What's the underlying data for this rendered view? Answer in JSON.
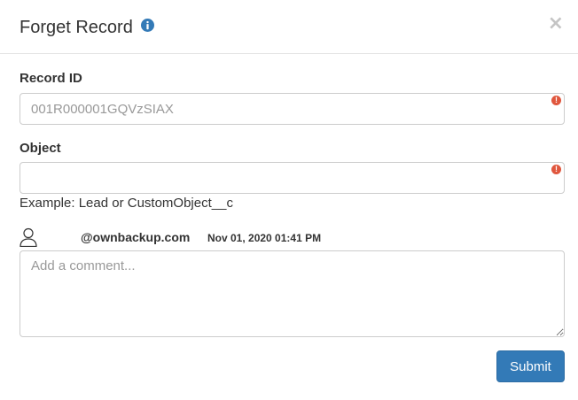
{
  "modal": {
    "title": "Forget Record",
    "close_glyph": "×"
  },
  "record_id": {
    "label": "Record ID",
    "value": "",
    "placeholder": "001R000001GQVzSIAX"
  },
  "object": {
    "label": "Object",
    "value": "",
    "placeholder": "",
    "help_text": "Example: Lead or CustomObject__c"
  },
  "comment": {
    "author_email": "@ownbackup.com",
    "timestamp": "Nov 01, 2020 01:41 PM",
    "placeholder": "Add a comment..."
  },
  "actions": {
    "submit_label": "Submit"
  },
  "colors": {
    "primary": "#337ab7",
    "error": "#e0573e",
    "info": "#337ab7"
  },
  "icons": {
    "info": "info-icon",
    "close": "close-icon",
    "error": "exclamation-icon",
    "user": "user-icon"
  }
}
